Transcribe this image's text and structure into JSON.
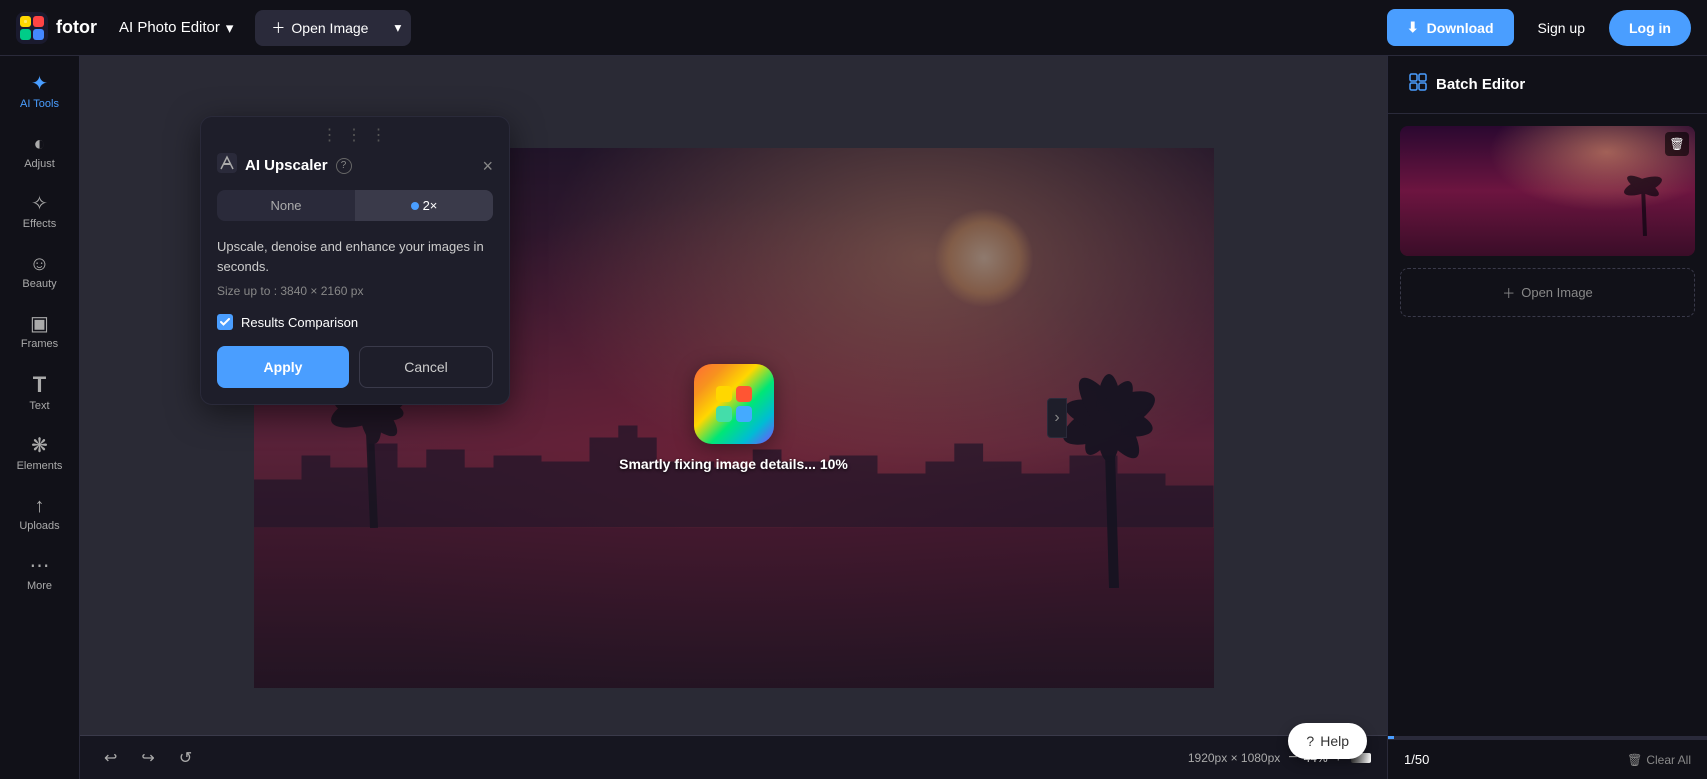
{
  "app": {
    "name": "fotor",
    "title": "AI Photo Editor",
    "title_chevron": "▾"
  },
  "header": {
    "open_image_label": "Open Image",
    "download_label": "Download",
    "sign_up_label": "Sign up",
    "log_in_label": "Log in"
  },
  "sidebar": {
    "items": [
      {
        "id": "ai-tools",
        "label": "AI Tools",
        "icon": "✦",
        "active": true
      },
      {
        "id": "adjust",
        "label": "Adjust",
        "icon": "◐"
      },
      {
        "id": "effects",
        "label": "Effects",
        "icon": "✧"
      },
      {
        "id": "beauty",
        "label": "Beauty",
        "icon": "☺"
      },
      {
        "id": "frames",
        "label": "Frames",
        "icon": "▣"
      },
      {
        "id": "text",
        "label": "Text",
        "icon": "T"
      },
      {
        "id": "elements",
        "label": "Elements",
        "icon": "❋"
      },
      {
        "id": "uploads",
        "label": "Uploads",
        "icon": "↑"
      },
      {
        "id": "more",
        "label": "More",
        "icon": "⋯"
      }
    ]
  },
  "panel": {
    "drag_handle": "⋮⋮⋮",
    "icon": "⬆",
    "title": "AI Upscaler",
    "help_icon": "?",
    "close_icon": "×",
    "toggle": {
      "none_label": "None",
      "2x_label": "2×",
      "active": "2x"
    },
    "description": "Upscale, denoise and enhance your images in seconds.",
    "size_label": "Size up to : 3840 × 2160 px",
    "checkbox_label": "Results Comparison",
    "checkbox_checked": true,
    "apply_label": "Apply",
    "cancel_label": "Cancel"
  },
  "canvas": {
    "processing_text": "Smartly fixing image details... 10%",
    "dimension_label": "1920px × 1080px",
    "zoom_label": "44%",
    "zoom_in_icon": "+",
    "zoom_out_icon": "−"
  },
  "right_panel": {
    "batch_editor_label": "Batch Editor",
    "add_image_label": "Open Image",
    "page_counter": "1/50",
    "clear_all_label": "Clear All",
    "delete_icon": "🗑"
  },
  "help": {
    "label": "Help",
    "icon": "?"
  }
}
